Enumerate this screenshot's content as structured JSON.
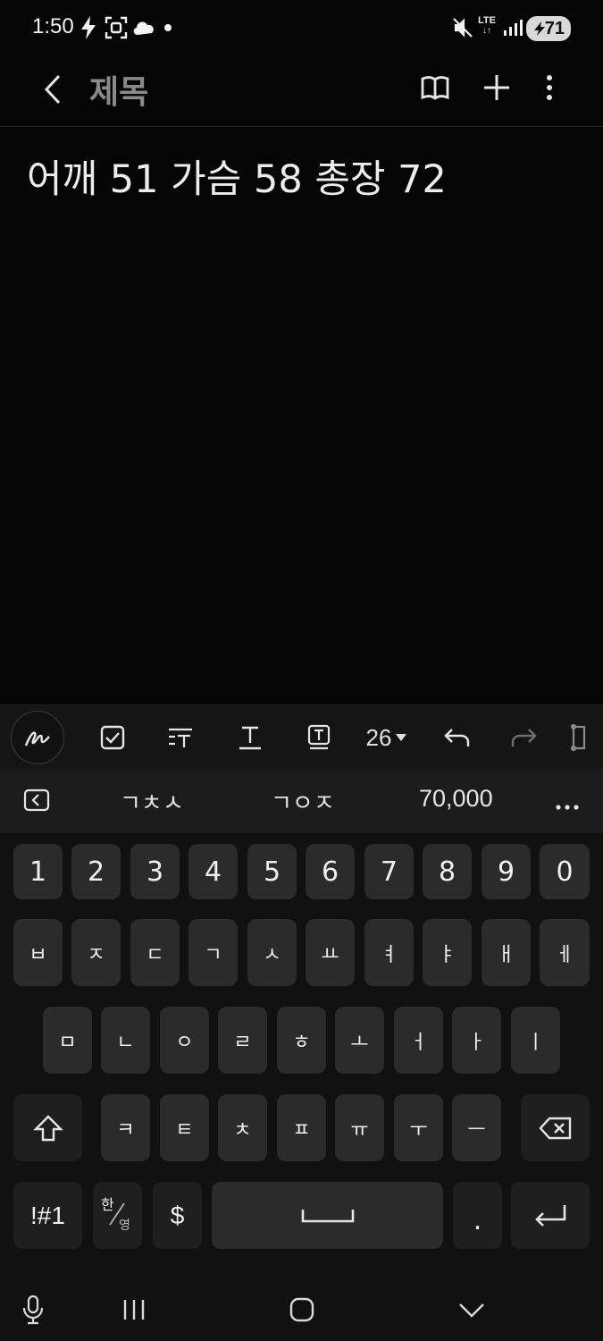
{
  "status_bar": {
    "time": "1:50",
    "network": "LTE",
    "battery": "71"
  },
  "header": {
    "title": "제목",
    "icons": [
      "back-icon",
      "reader-mode-icon",
      "add-icon",
      "more-icon"
    ]
  },
  "note": {
    "body": "어깨 51 가슴 58 총장 72"
  },
  "toolbar": {
    "font_size": "26",
    "icons": [
      "pen-icon",
      "checkbox-icon",
      "paragraph-style-icon",
      "text-style-icon",
      "text-box-icon",
      "undo-icon",
      "redo-icon",
      "more-toolbar-icon"
    ]
  },
  "suggestions": {
    "items": [
      "ㄱㅊㅅ",
      "ㄱㅇㅈ",
      "70,000"
    ]
  },
  "keyboard": {
    "row_numbers": [
      "1",
      "2",
      "3",
      "4",
      "5",
      "6",
      "7",
      "8",
      "9",
      "0"
    ],
    "row1": [
      "ㅂ",
      "ㅈ",
      "ㄷ",
      "ㄱ",
      "ㅅ",
      "ㅛ",
      "ㅕ",
      "ㅑ",
      "ㅐ",
      "ㅔ"
    ],
    "row2": [
      "ㅁ",
      "ㄴ",
      "ㅇ",
      "ㄹ",
      "ㅎ",
      "ㅗ",
      "ㅓ",
      "ㅏ",
      "ㅣ"
    ],
    "row3": [
      "ㅋ",
      "ㅌ",
      "ㅊ",
      "ㅍ",
      "ㅠ",
      "ㅜ",
      "ㅡ"
    ],
    "symbols_key": "!#1",
    "lang_top": "한",
    "lang_bottom": "영",
    "currency_key": "$",
    "period_key": "."
  },
  "colors": {
    "background": "#050505",
    "key": "#2b2b2d",
    "function_key": "#1f1f21",
    "title_placeholder": "#8a8a8a"
  }
}
